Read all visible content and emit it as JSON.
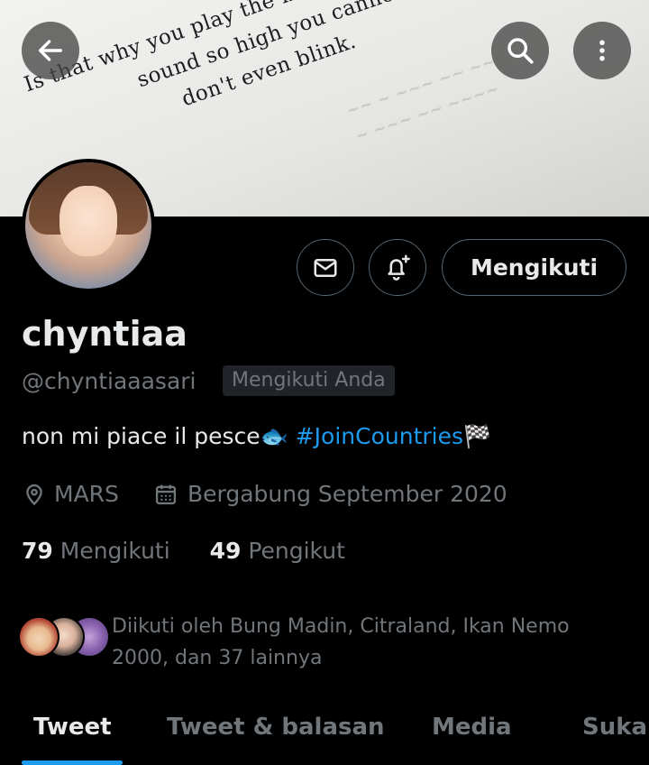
{
  "banner": {
    "lines": [
      "Is that why you play the music so loud? I",
      "sound so high you cannot think, ly",
      "don't even blink."
    ],
    "icons": {
      "back": "arrow-left-icon",
      "search": "search-icon",
      "more": "more-vertical-icon"
    }
  },
  "profile": {
    "display_name": "chyntiaa",
    "handle": "@chyntiaaasari",
    "follows_you_badge": "Mengikuti Anda",
    "bio_text": "non mi piace il pesce",
    "bio_emoji_fish": "🐟",
    "bio_hashtag": "#JoinCountries",
    "bio_emoji_flag": "🏁",
    "location": "MARS",
    "joined": "Bergabung September 2020",
    "following_count": "79",
    "following_label": "Mengikuti",
    "followers_count": "49",
    "followers_label": "Pengikut",
    "followed_by_text": "Diikuti oleh Bung Madin, Citraland, Ikan Nemo 2000, dan 37 lainnya"
  },
  "actions": {
    "message_icon": "envelope-icon",
    "notify_icon": "bell-plus-icon",
    "follow_label": "Mengikuti"
  },
  "tabs": [
    {
      "label": "Tweet",
      "active": true
    },
    {
      "label": "Tweet & balasan",
      "active": false
    },
    {
      "label": "Media",
      "active": false
    },
    {
      "label": "Suka",
      "active": false
    }
  ],
  "colors": {
    "accent": "#1d9bf0",
    "background": "#000000",
    "muted": "#71767b",
    "text": "#e7e9ea"
  }
}
